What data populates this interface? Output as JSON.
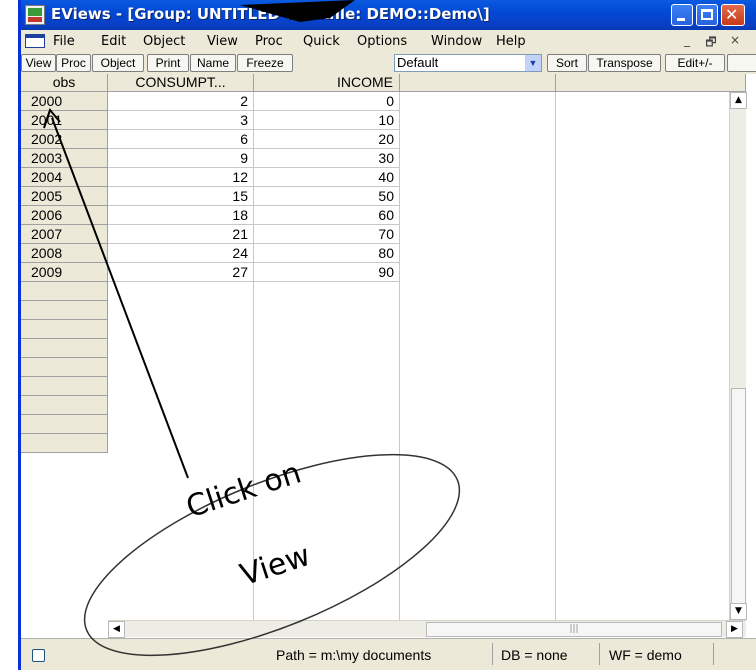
{
  "window": {
    "title": "EViews - [Group: UNTITLED   Workfile: DEMO::Demo\\]",
    "close_glyph": "✕"
  },
  "menubar": {
    "items": [
      "File",
      "Edit",
      "Object",
      "View",
      "Proc",
      "Quick",
      "Options",
      "Window",
      "Help"
    ],
    "mdi_minimize": "_",
    "mdi_restore": "🗗",
    "mdi_close": "×"
  },
  "toolbar": {
    "buttons": [
      "View",
      "Proc",
      "Object",
      "Print",
      "Name",
      "Freeze",
      "Sort",
      "Transpose",
      "Edit+/-"
    ],
    "display_format": "Default"
  },
  "grid": {
    "columns": [
      "obs",
      "CONSUMPT...",
      "INCOME"
    ],
    "rows": [
      {
        "obs": "2000",
        "consumption": "2",
        "income": "0"
      },
      {
        "obs": "2001",
        "consumption": "3",
        "income": "10"
      },
      {
        "obs": "2002",
        "consumption": "6",
        "income": "20"
      },
      {
        "obs": "2003",
        "consumption": "9",
        "income": "30"
      },
      {
        "obs": "2004",
        "consumption": "12",
        "income": "40"
      },
      {
        "obs": "2005",
        "consumption": "15",
        "income": "50"
      },
      {
        "obs": "2006",
        "consumption": "18",
        "income": "60"
      },
      {
        "obs": "2007",
        "consumption": "21",
        "income": "70"
      },
      {
        "obs": "2008",
        "consumption": "24",
        "income": "80"
      },
      {
        "obs": "2009",
        "consumption": "27",
        "income": "90"
      }
    ],
    "empty_rows": 9
  },
  "statusbar": {
    "path": "Path = m:\\my documents",
    "db": "DB = none",
    "wf": "WF = demo"
  },
  "annotation": {
    "line1": "Click on",
    "line2": "View"
  },
  "colors": {
    "titlebar": "#0a4fd8",
    "chrome": "#ece9d8",
    "close_button": "#c8391b"
  }
}
